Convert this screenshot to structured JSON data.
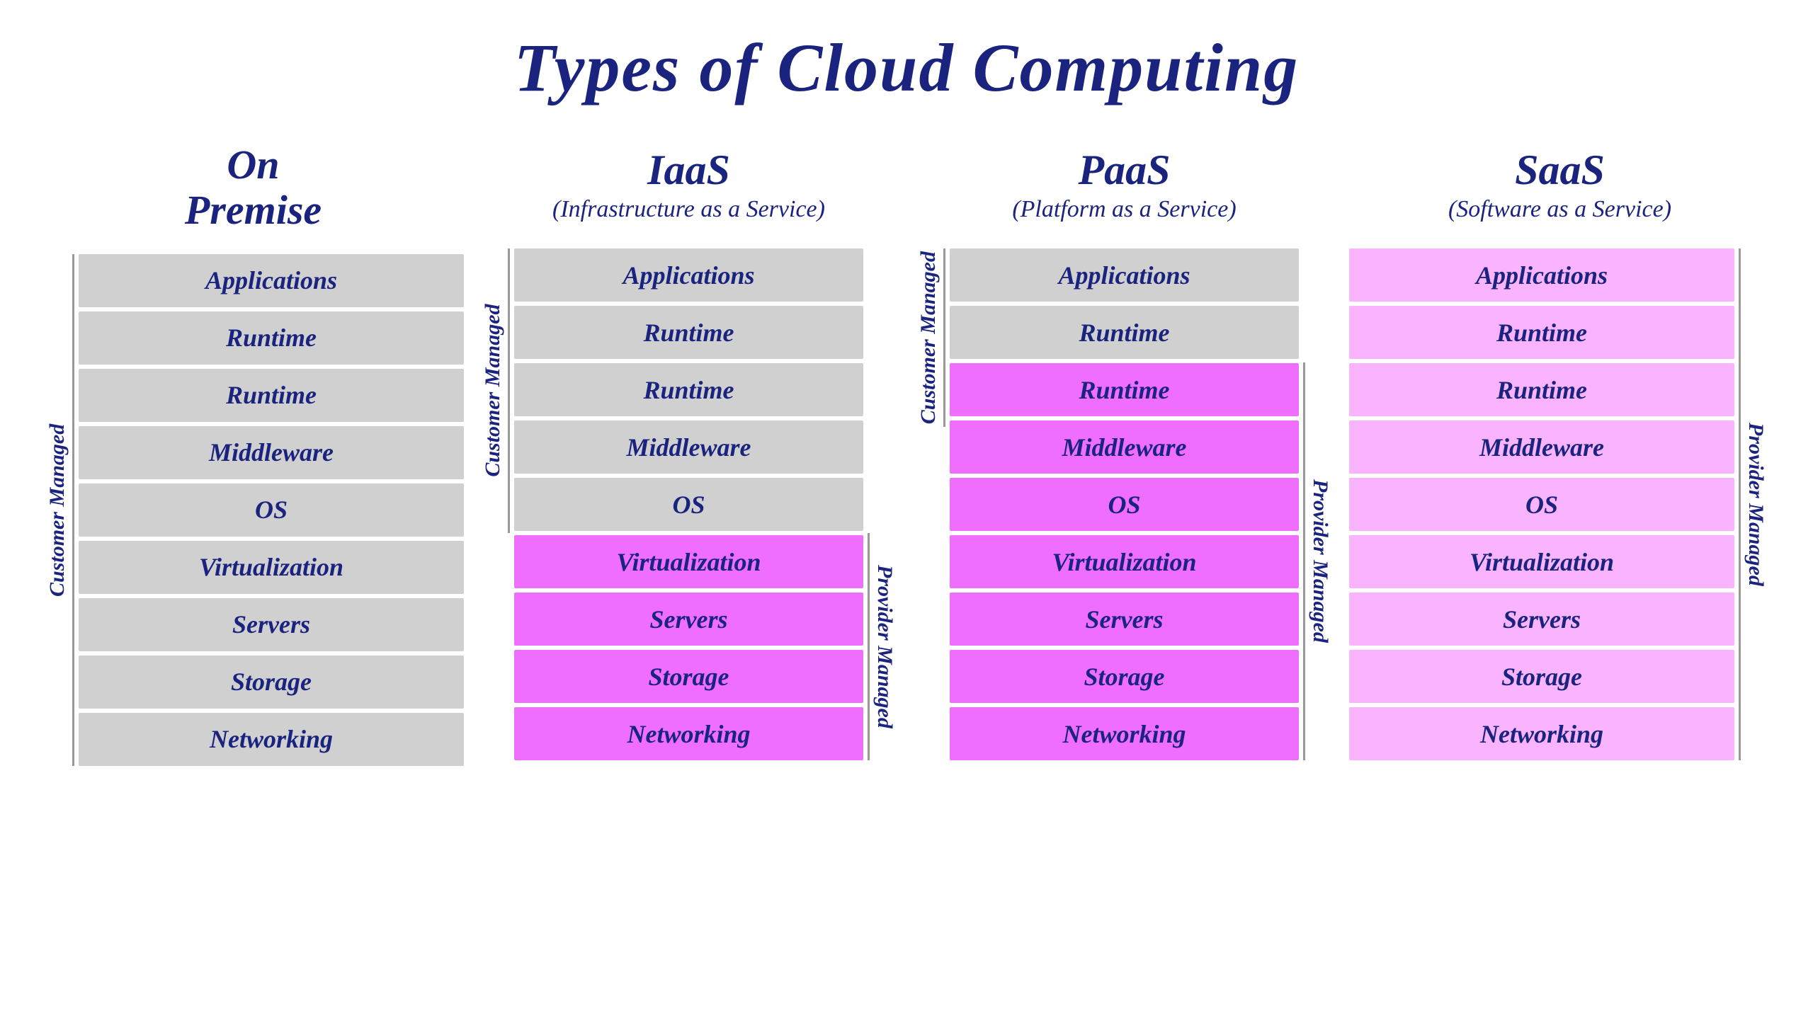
{
  "title": "Types of Cloud Computing",
  "columns": [
    {
      "id": "on-premise",
      "title": "On\nPremise",
      "subtitle": "",
      "left_label": "Customer Managed",
      "right_label": null,
      "rows": [
        {
          "label": "Applications",
          "color": "gray"
        },
        {
          "label": "Runtime",
          "color": "gray"
        },
        {
          "label": "Runtime",
          "color": "gray"
        },
        {
          "label": "Middleware",
          "color": "gray"
        },
        {
          "label": "OS",
          "color": "gray"
        },
        {
          "label": "Virtualization",
          "color": "gray"
        },
        {
          "label": "Servers",
          "color": "gray"
        },
        {
          "label": "Storage",
          "color": "gray"
        },
        {
          "label": "Networking",
          "color": "gray"
        }
      ]
    },
    {
      "id": "iaas",
      "title": "IaaS",
      "subtitle": "(Infrastructure as a Service)",
      "left_label": "Customer Managed",
      "right_label": "Provider Managed",
      "customer_rows": 5,
      "rows": [
        {
          "label": "Applications",
          "color": "gray"
        },
        {
          "label": "Runtime",
          "color": "gray"
        },
        {
          "label": "Runtime",
          "color": "gray"
        },
        {
          "label": "Middleware",
          "color": "gray"
        },
        {
          "label": "OS",
          "color": "gray"
        },
        {
          "label": "Virtualization",
          "color": "pink"
        },
        {
          "label": "Servers",
          "color": "pink"
        },
        {
          "label": "Storage",
          "color": "pink"
        },
        {
          "label": "Networking",
          "color": "pink"
        }
      ]
    },
    {
      "id": "paas",
      "title": "PaaS",
      "subtitle": "(Platform as a Service)",
      "left_label": "Customer Managed",
      "right_label": "Provider Managed",
      "customer_rows": 2,
      "rows": [
        {
          "label": "Applications",
          "color": "gray"
        },
        {
          "label": "Runtime",
          "color": "gray"
        },
        {
          "label": "Runtime",
          "color": "pink"
        },
        {
          "label": "Middleware",
          "color": "pink"
        },
        {
          "label": "OS",
          "color": "pink"
        },
        {
          "label": "Virtualization",
          "color": "pink"
        },
        {
          "label": "Servers",
          "color": "pink"
        },
        {
          "label": "Storage",
          "color": "pink"
        },
        {
          "label": "Networking",
          "color": "pink"
        }
      ]
    },
    {
      "id": "saas",
      "title": "SaaS",
      "subtitle": "(Software as a Service)",
      "left_label": null,
      "right_label": "Provider Managed",
      "customer_rows": 0,
      "rows": [
        {
          "label": "Applications",
          "color": "light-pink"
        },
        {
          "label": "Runtime",
          "color": "light-pink"
        },
        {
          "label": "Runtime",
          "color": "light-pink"
        },
        {
          "label": "Middleware",
          "color": "light-pink"
        },
        {
          "label": "OS",
          "color": "light-pink"
        },
        {
          "label": "Virtualization",
          "color": "light-pink"
        },
        {
          "label": "Servers",
          "color": "light-pink"
        },
        {
          "label": "Storage",
          "color": "light-pink"
        },
        {
          "label": "Networking",
          "color": "light-pink"
        }
      ]
    }
  ],
  "colors": {
    "gray": "#d0d0d0",
    "pink": "#f06eff",
    "light_pink": "#f9b3ff",
    "title_blue": "#1a237e",
    "bracket_gray": "#999999"
  }
}
